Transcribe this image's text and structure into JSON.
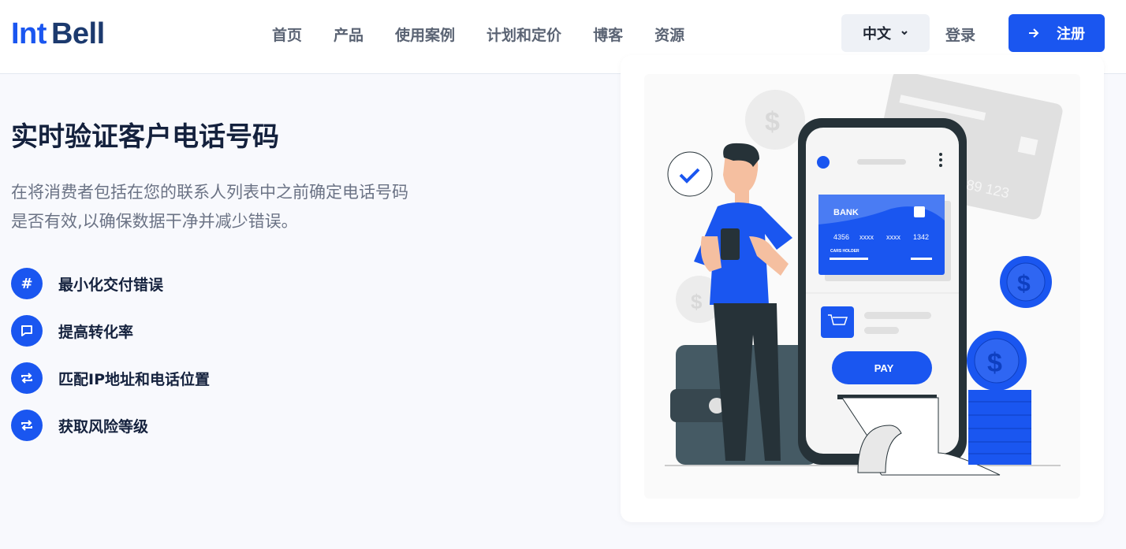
{
  "header": {
    "logo": {
      "part1": "Int",
      "part2": "Bell"
    },
    "nav": [
      "首页",
      "产品",
      "使用案例",
      "计划和定价",
      "博客",
      "资源"
    ],
    "language": "中文",
    "login": "登录",
    "signup": "注册"
  },
  "hero": {
    "title": "实时验证客户电话号码",
    "description_line1": "在将消费者包括在您的联系人列表中之前确定电话号码",
    "description_line2": "是否有效,以确保数据干净并减少错误。",
    "features": [
      {
        "icon": "hash-icon",
        "label": "最小化交付错误"
      },
      {
        "icon": "chat-icon",
        "label": "提高转化率"
      },
      {
        "icon": "repeat-icon",
        "label": "匹配IP地址和电话位置"
      },
      {
        "icon": "repeat-icon",
        "label": "获取风险等级"
      }
    ]
  },
  "illustration": {
    "bank": "BANK",
    "card_number": [
      "4356",
      "xxxx",
      "xxxx",
      "1342"
    ],
    "card_holder": "CARS HOLDER",
    "pay": "PAY",
    "back_card_number": "789 123",
    "colors": {
      "accent": "#1a56f0",
      "dark": "#263238"
    }
  }
}
